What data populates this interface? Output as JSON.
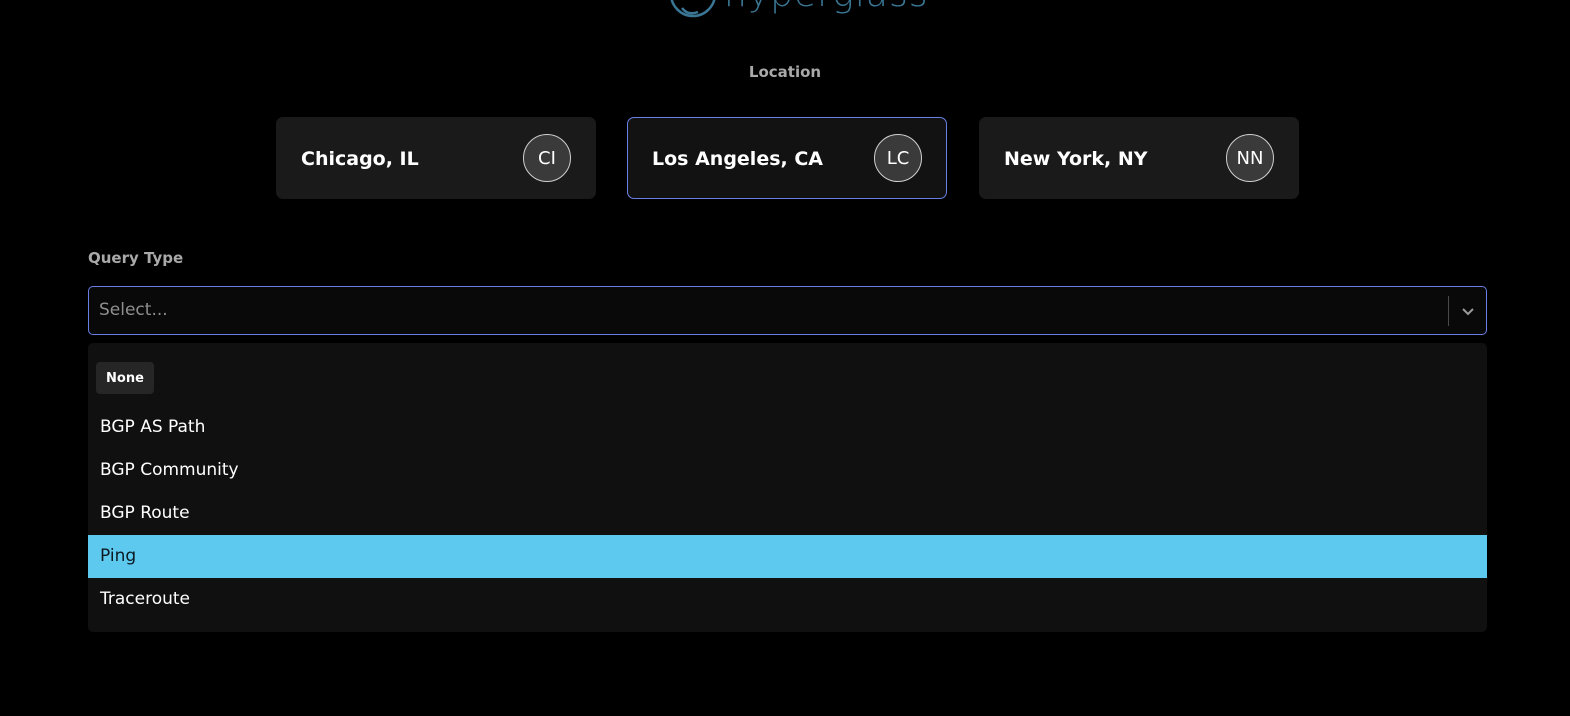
{
  "logo": {
    "text": "hyperglass"
  },
  "location": {
    "label": "Location",
    "cards": [
      {
        "name": "Chicago, IL",
        "initials": "CI",
        "selected": false
      },
      {
        "name": "Los Angeles, CA",
        "initials": "LC",
        "selected": true
      },
      {
        "name": "New York, NY",
        "initials": "NN",
        "selected": false
      }
    ]
  },
  "query_type": {
    "label": "Query Type",
    "placeholder": "Select...",
    "value": "",
    "dropdown": {
      "group_label": "None",
      "options": [
        "BGP AS Path",
        "BGP Community",
        "BGP Route",
        "Ping",
        "Traceroute"
      ],
      "highlighted": "Ping"
    }
  },
  "colors": {
    "accent": "#6a7fe3",
    "highlight": "#5ec9ef",
    "logo": "#3a7694"
  },
  "icons": {
    "logo": "hyperglass-logo-icon",
    "dropdown": "chevron-down-icon"
  }
}
